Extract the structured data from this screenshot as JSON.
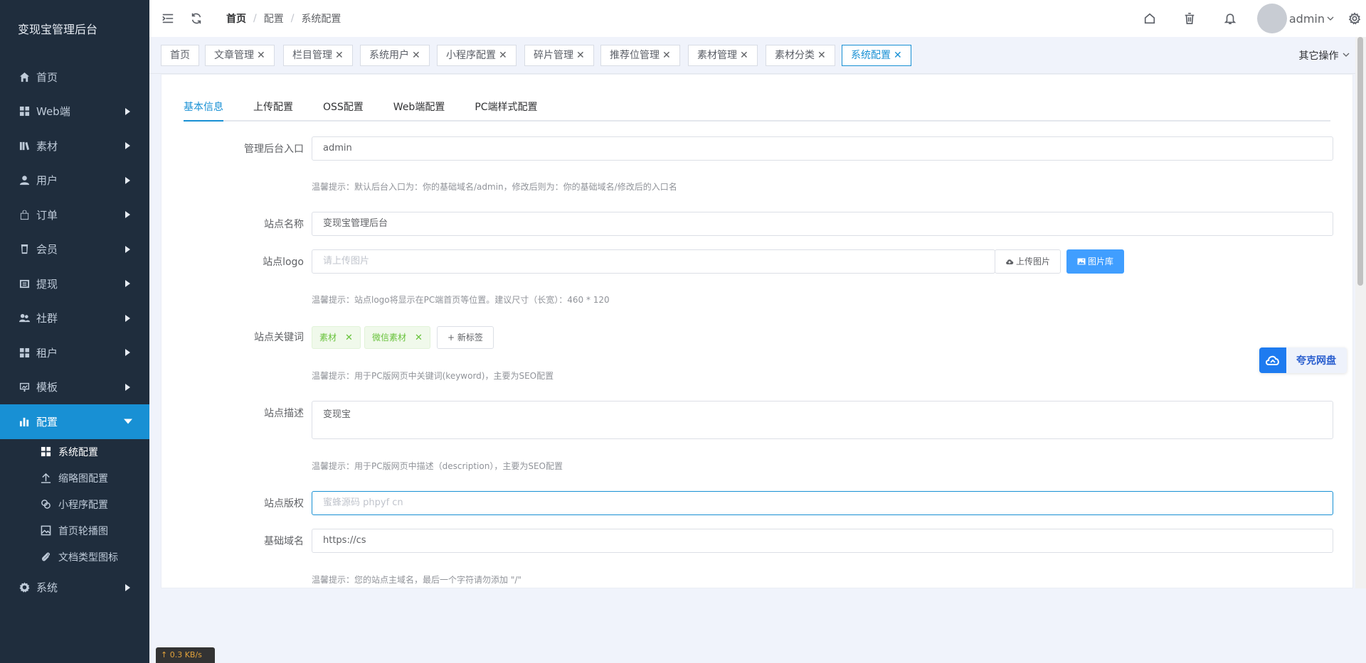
{
  "sidebar": {
    "brand": "变现宝管理后台",
    "items": [
      {
        "label": "首页",
        "icon": "home-icon",
        "has_children": false
      },
      {
        "label": "Web端",
        "icon": "grid-icon",
        "has_children": true
      },
      {
        "label": "素材",
        "icon": "library-icon",
        "has_children": true
      },
      {
        "label": "用户",
        "icon": "user-icon",
        "has_children": true
      },
      {
        "label": "订单",
        "icon": "bag-icon",
        "has_children": true
      },
      {
        "label": "会员",
        "icon": "cup-icon",
        "has_children": true
      },
      {
        "label": "提现",
        "icon": "wallet-icon",
        "has_children": true
      },
      {
        "label": "社群",
        "icon": "group-icon",
        "has_children": true
      },
      {
        "label": "租户",
        "icon": "grid-icon",
        "has_children": true
      },
      {
        "label": "模板",
        "icon": "board-icon",
        "has_children": true
      },
      {
        "label": "配置",
        "icon": "bar-chart-icon",
        "has_children": true,
        "active": true
      },
      {
        "label": "系统",
        "icon": "gear-icon",
        "has_children": true
      }
    ],
    "submenu": [
      {
        "label": "系统配置",
        "icon": "grid-icon",
        "current": true
      },
      {
        "label": "缩略图配置",
        "icon": "upload-icon"
      },
      {
        "label": "小程序配置",
        "icon": "link-icon"
      },
      {
        "label": "首页轮播图",
        "icon": "image-icon"
      },
      {
        "label": "文档类型图标",
        "icon": "paperclip-icon"
      }
    ]
  },
  "header": {
    "breadcrumb": [
      "首页",
      "配置",
      "系统配置"
    ],
    "username": "admin"
  },
  "tags": [
    {
      "label": "首页",
      "closable": false
    },
    {
      "label": "文章管理",
      "closable": true
    },
    {
      "label": "栏目管理",
      "closable": true
    },
    {
      "label": "系统用户",
      "closable": true
    },
    {
      "label": "小程序配置",
      "closable": true
    },
    {
      "label": "碎片管理",
      "closable": true
    },
    {
      "label": "推荐位管理",
      "closable": true
    },
    {
      "label": "素材管理",
      "closable": true
    },
    {
      "label": "素材分类",
      "closable": true
    },
    {
      "label": "系统配置",
      "closable": true,
      "active": true
    }
  ],
  "other_ops": "其它操作",
  "tabs": [
    "基本信息",
    "上传配置",
    "OSS配置",
    "Web端配置",
    "PC端样式配置"
  ],
  "form": {
    "admin_entry": {
      "label": "管理后台入口",
      "value": "admin",
      "tip": "温馨提示：默认后台入口为：你的基础域名/admin，修改后则为：你的基础域名/修改后的入口名"
    },
    "site_name": {
      "label": "站点名称",
      "value": "变现宝管理后台"
    },
    "site_logo": {
      "label": "站点logo",
      "placeholder": "请上传图片",
      "upload_btn": "上传图片",
      "library_btn": "图片库",
      "tip": "温馨提示：站点logo将显示在PC端首页等位置。建议尺寸（长宽）：460 * 120"
    },
    "keywords": {
      "label": "站点关键词",
      "tags": [
        "素材",
        "微信素材"
      ],
      "new_tag": "+ 新标签",
      "tip": "温馨提示：用于PC版网页中关键词(keyword)，主要为SEO配置"
    },
    "description": {
      "label": "站点描述",
      "value": "变现宝",
      "tip": "温馨提示：用于PC版网页中描述（description），主要为SEO配置"
    },
    "copyright": {
      "label": "站点版权",
      "placeholder": "蜜蜂源码 phpyf cn"
    },
    "base_domain": {
      "label": "基础域名",
      "value": "https://cs",
      "tip": "温馨提示：您的站点主域名，最后一个字符请勿添加 \"/\""
    }
  },
  "floating_badge": "夸克网盘",
  "speed": "↑ 0.3 KB/s"
}
